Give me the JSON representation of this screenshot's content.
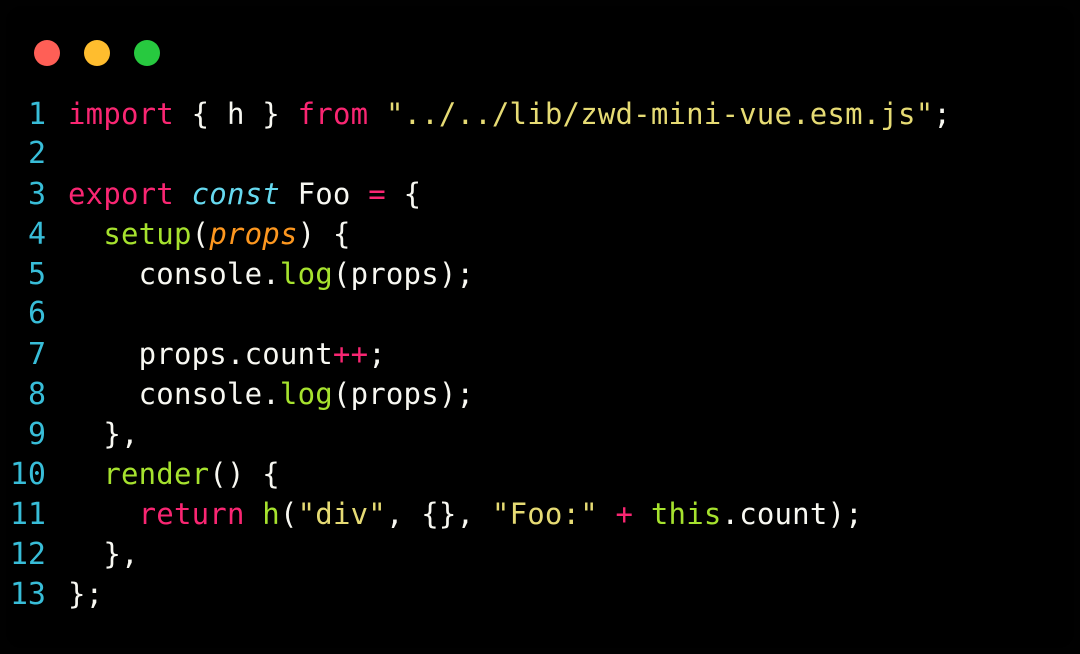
{
  "window": {
    "dots": [
      {
        "name": "close-dot",
        "color": "#FF5F56"
      },
      {
        "name": "minimize-dot",
        "color": "#FFBD2E"
      },
      {
        "name": "maximize-dot",
        "color": "#27C93F"
      }
    ]
  },
  "editor": {
    "language": "javascript",
    "theme": "monokai",
    "background": "#000000",
    "line_number_color": "#38BDD8",
    "colors": {
      "plain": "#F8F8F2",
      "keyword": "#F92672",
      "storage": "#66D9EF",
      "function": "#A6E22E",
      "string": "#E6DB74",
      "parameter": "#FD971F",
      "operator": "#F92672"
    },
    "lines": [
      {
        "number": "1",
        "text": "import { h } from \"../../lib/zwd-mini-vue.esm.js\";",
        "tokens": [
          {
            "t": "import",
            "c": "t-keyword"
          },
          {
            "t": " ",
            "c": "t-plain"
          },
          {
            "t": "{ h }",
            "c": "t-plain"
          },
          {
            "t": " ",
            "c": "t-plain"
          },
          {
            "t": "from",
            "c": "t-keyword"
          },
          {
            "t": " ",
            "c": "t-plain"
          },
          {
            "t": "\"../../lib/zwd-mini-vue.esm.js\"",
            "c": "t-string"
          },
          {
            "t": ";",
            "c": "t-plain"
          }
        ]
      },
      {
        "number": "2",
        "text": "",
        "tokens": []
      },
      {
        "number": "3",
        "text": "export const Foo = {",
        "tokens": [
          {
            "t": "export",
            "c": "t-keyword"
          },
          {
            "t": " ",
            "c": "t-plain"
          },
          {
            "t": "const",
            "c": "t-storage"
          },
          {
            "t": " Foo ",
            "c": "t-plain"
          },
          {
            "t": "=",
            "c": "t-operator"
          },
          {
            "t": " {",
            "c": "t-plain"
          }
        ]
      },
      {
        "number": "4",
        "text": "  setup(props) {",
        "tokens": [
          {
            "t": "  ",
            "c": "t-plain"
          },
          {
            "t": "setup",
            "c": "t-func"
          },
          {
            "t": "(",
            "c": "t-plain"
          },
          {
            "t": "props",
            "c": "t-param"
          },
          {
            "t": ") {",
            "c": "t-plain"
          }
        ]
      },
      {
        "number": "5",
        "text": "    console.log(props);",
        "tokens": [
          {
            "t": "    console.",
            "c": "t-plain"
          },
          {
            "t": "log",
            "c": "t-func"
          },
          {
            "t": "(props);",
            "c": "t-plain"
          }
        ]
      },
      {
        "number": "6",
        "text": "",
        "tokens": []
      },
      {
        "number": "7",
        "text": "    props.count++;",
        "tokens": [
          {
            "t": "    props.count",
            "c": "t-plain"
          },
          {
            "t": "++",
            "c": "t-operator"
          },
          {
            "t": ";",
            "c": "t-plain"
          }
        ]
      },
      {
        "number": "8",
        "text": "    console.log(props);",
        "tokens": [
          {
            "t": "    console.",
            "c": "t-plain"
          },
          {
            "t": "log",
            "c": "t-func"
          },
          {
            "t": "(props);",
            "c": "t-plain"
          }
        ]
      },
      {
        "number": "9",
        "text": "  },",
        "tokens": [
          {
            "t": "  },",
            "c": "t-plain"
          }
        ]
      },
      {
        "number": "10",
        "text": "  render() {",
        "tokens": [
          {
            "t": "  ",
            "c": "t-plain"
          },
          {
            "t": "render",
            "c": "t-func"
          },
          {
            "t": "() {",
            "c": "t-plain"
          }
        ]
      },
      {
        "number": "11",
        "text": "    return h(\"div\", {}, \"Foo:\" + this.count);",
        "tokens": [
          {
            "t": "    ",
            "c": "t-plain"
          },
          {
            "t": "return",
            "c": "t-keyword"
          },
          {
            "t": " ",
            "c": "t-plain"
          },
          {
            "t": "h",
            "c": "t-func"
          },
          {
            "t": "(",
            "c": "t-plain"
          },
          {
            "t": "\"div\"",
            "c": "t-string"
          },
          {
            "t": ", {}, ",
            "c": "t-plain"
          },
          {
            "t": "\"Foo:\"",
            "c": "t-string"
          },
          {
            "t": " ",
            "c": "t-plain"
          },
          {
            "t": "+",
            "c": "t-operator"
          },
          {
            "t": " ",
            "c": "t-plain"
          },
          {
            "t": "this",
            "c": "t-this"
          },
          {
            "t": ".count);",
            "c": "t-plain"
          }
        ]
      },
      {
        "number": "12",
        "text": "  },",
        "tokens": [
          {
            "t": "  },",
            "c": "t-plain"
          }
        ]
      },
      {
        "number": "13",
        "text": "};",
        "tokens": [
          {
            "t": "};",
            "c": "t-plain"
          }
        ]
      }
    ]
  }
}
